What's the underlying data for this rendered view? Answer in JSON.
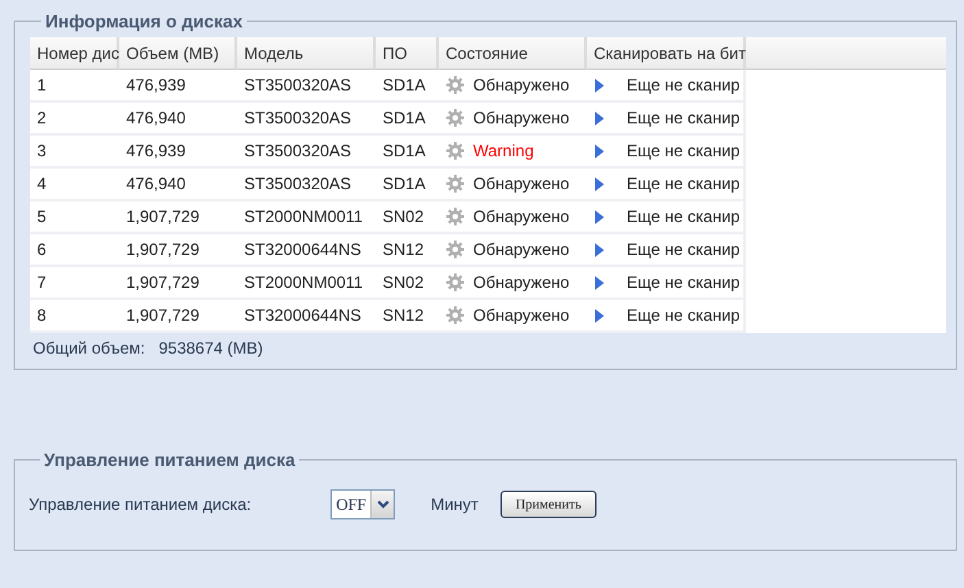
{
  "disk_info": {
    "title": "Информация о дисках",
    "columns": [
      "Номер дис",
      "Объем (MB)",
      "Модель",
      "ПО",
      "Состояние",
      "Сканировать на бит"
    ],
    "rows": [
      {
        "number": "1",
        "size": "476,939",
        "model": "ST3500320AS",
        "firmware": "SD1A",
        "status": "Обнаружено",
        "warning": false,
        "scan": "Еще не сканир"
      },
      {
        "number": "2",
        "size": "476,940",
        "model": "ST3500320AS",
        "firmware": "SD1A",
        "status": "Обнаружено",
        "warning": false,
        "scan": "Еще не сканир"
      },
      {
        "number": "3",
        "size": "476,939",
        "model": "ST3500320AS",
        "firmware": "SD1A",
        "status": "Warning",
        "warning": true,
        "scan": "Еще не сканир"
      },
      {
        "number": "4",
        "size": "476,940",
        "model": "ST3500320AS",
        "firmware": "SD1A",
        "status": "Обнаружено",
        "warning": false,
        "scan": "Еще не сканир"
      },
      {
        "number": "5",
        "size": "1,907,729",
        "model": "ST2000NM0011",
        "firmware": "SN02",
        "status": "Обнаружено",
        "warning": false,
        "scan": "Еще не сканир"
      },
      {
        "number": "6",
        "size": "1,907,729",
        "model": "ST32000644NS",
        "firmware": "SN12",
        "status": "Обнаружено",
        "warning": false,
        "scan": "Еще не сканир"
      },
      {
        "number": "7",
        "size": "1,907,729",
        "model": "ST2000NM0011",
        "firmware": "SN02",
        "status": "Обнаружено",
        "warning": false,
        "scan": "Еще не сканир"
      },
      {
        "number": "8",
        "size": "1,907,729",
        "model": "ST32000644NS",
        "firmware": "SN12",
        "status": "Обнаружено",
        "warning": false,
        "scan": "Еще не сканир"
      }
    ],
    "total_label": "Общий объем:",
    "total_value": "9538674 (MB)"
  },
  "power": {
    "title": "Управление питанием диска",
    "label": "Управление питанием диска:",
    "select_value": "OFF",
    "unit": "Минут",
    "apply_button": "Применить"
  }
}
